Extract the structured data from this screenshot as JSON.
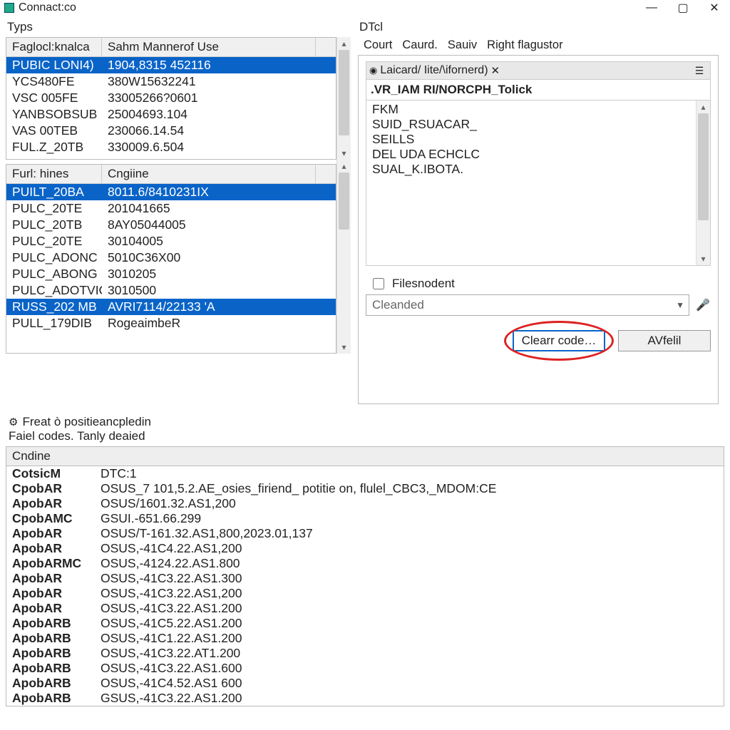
{
  "window": {
    "title": "Connact:co"
  },
  "left": {
    "typeLabel": "Typs",
    "top": {
      "headers": [
        "Faglocl:knalca",
        "Sahm Mannerof Use"
      ],
      "rows": [
        {
          "a": "PUBIC LONI4)",
          "b": "1904,8315 452116",
          "sel": true
        },
        {
          "a": "YCS480FE",
          "b": "380W15632241"
        },
        {
          "a": "VSC 005FE",
          "b": "33005266?0601"
        },
        {
          "a": "YANBSOBSUB",
          "b": "25004693.104"
        },
        {
          "a": "VAS 00TEB",
          "b": "230066.14.54"
        },
        {
          "a": "FUL.Z_20TB",
          "b": "330009.6.504"
        }
      ]
    },
    "mid": {
      "headers": [
        "Furl: hines",
        "Cngiine"
      ],
      "rows": [
        {
          "a": "PUILT_20BA",
          "b": "8011.6/8410231IX",
          "sel": true
        },
        {
          "a": "PULC_20TE",
          "b": "201041665"
        },
        {
          "a": "PULC_20TВ",
          "b": "8AY05044005"
        },
        {
          "a": "PULC_20TE",
          "b": "30104005"
        },
        {
          "a": "PULC_ADONC",
          "b": "5010C36X00"
        },
        {
          "a": "PULC_ABONG",
          "b": "3010205"
        },
        {
          "a": "PULC_ADOTVIC",
          "b": "3010500"
        },
        {
          "a": "RUSS_202 MB",
          "b": "AVRI7114/22133 'A",
          "sel": true
        },
        {
          "a": "PULL_179DIB",
          "b": "RogeaimbeR"
        }
      ]
    }
  },
  "right": {
    "sectionLabel": "DTcl",
    "tabs": [
      "Court",
      "Caurd.",
      "Sauiv",
      "Right flagustor"
    ],
    "subtab": "Laicard/ Iite/\\ifornerd)",
    "subheader": ".VR_IAM RI/NORCPH_Tolick",
    "files": [
      "FKM",
      "SUID_RSUACAR_",
      "SEILLS",
      "DEL UDA ECHCLC",
      "SUAL_K.IBOTA."
    ],
    "checkbox": "Filesnodent",
    "select": "Cleanded",
    "btnPrimary": "Clearr code…",
    "btnSecondary": "AVfelil"
  },
  "status": {
    "line1": "Freat ò positieancpledin",
    "line2": "Faiel codes. Tanly deaied"
  },
  "bottom": {
    "header": "Cndine",
    "rows": [
      {
        "a": "CotsicM",
        "b": "DTC:1"
      },
      {
        "a": "CpobAR",
        "b": "OSUS_7 101,5.2.AE_osies_firiend_ potitie on, flulel_CBC3,_MDOM:CE"
      },
      {
        "a": "ApobAR",
        "b": "OSUS/1601.32.AS1,200"
      },
      {
        "a": "CpobAMC",
        "b": "GSUI.-651.66.299"
      },
      {
        "a": "ApobAR",
        "b": "OSUS/T-161.32.AS1,800,2023.01,137"
      },
      {
        "a": "ApobAR",
        "b": "OSUS,-41C4.22.AS1,200"
      },
      {
        "a": "ApobARMC",
        "b": "OSUS,-4124.22.AS1.800"
      },
      {
        "a": "ApobAR",
        "b": "OSUS,-41C3.22.AS1.300"
      },
      {
        "a": "ApobAR",
        "b": "OSUS,-41C3.22.AS1,200"
      },
      {
        "a": "ApobAR",
        "b": "OSUS,-41C3.22.AS1.200"
      },
      {
        "a": "ApobARB",
        "b": "OSUS,-41C5.22.AS1.200"
      },
      {
        "a": "ApobARB",
        "b": "OSUS,-41C1.22.AS1.200"
      },
      {
        "a": "ApobARB",
        "b": "OSUS,-41C3.22.AT1.200"
      },
      {
        "a": "ApobARB",
        "b": "OSUS,-41C3.22.AS1.600"
      },
      {
        "a": "ApobARB",
        "b": "OSUS,-41C4.52.AS1 600"
      },
      {
        "a": "ApobARB",
        "b": "GSUS,-41C3.22.AS1.200"
      }
    ]
  }
}
